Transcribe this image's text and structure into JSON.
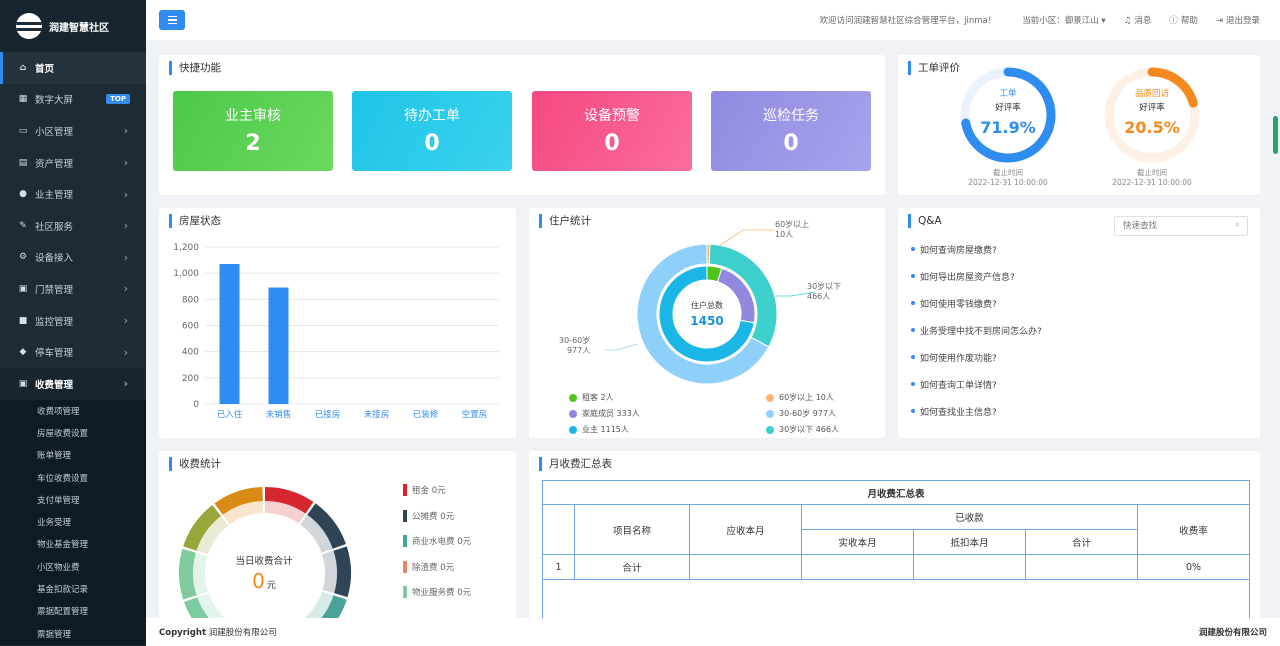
{
  "app": {
    "title": "润建智慧社区"
  },
  "sidebar": {
    "items": [
      {
        "label": "首页",
        "icon": "home-icon",
        "glyph": "⌂",
        "active": true
      },
      {
        "label": "数字大屏",
        "icon": "chart-icon",
        "glyph": "▦",
        "badge": "TOP"
      },
      {
        "label": "小区管理",
        "icon": "monitor-icon",
        "glyph": "▭",
        "arrow": "›"
      },
      {
        "label": "资产管理",
        "icon": "document-icon",
        "glyph": "▤",
        "arrow": "›"
      },
      {
        "label": "业主管理",
        "icon": "user-icon",
        "glyph": "●",
        "arrow": "›"
      },
      {
        "label": "社区服务",
        "icon": "edit-icon",
        "glyph": "✎",
        "arrow": "›"
      },
      {
        "label": "设备接入",
        "icon": "gear-icon",
        "glyph": "⚙",
        "arrow": "›"
      },
      {
        "label": "门禁管理",
        "icon": "card-icon",
        "glyph": "▣",
        "arrow": "›"
      },
      {
        "label": "监控管理",
        "icon": "camera-icon",
        "glyph": "■",
        "arrow": "›"
      },
      {
        "label": "停车管理",
        "icon": "car-icon",
        "glyph": "◆",
        "arrow": "›"
      },
      {
        "label": "收费管理",
        "icon": "money-icon",
        "glyph": "▣",
        "arrow": "›",
        "open": true
      }
    ],
    "sub_items": [
      "收费项管理",
      "房屋收费设置",
      "账单管理",
      "车位收费设置",
      "支付单管理",
      "业务受理",
      "物业基金管理",
      "小区物业费",
      "基金扣款记录",
      "票据配置管理",
      "票据管理"
    ]
  },
  "header": {
    "welcome": "欢迎访问润建智慧社区综合管理平台，jinma！",
    "community": "当前小区：御景江山 ▾",
    "messages": "消息",
    "help": "帮助",
    "logout": "退出登录"
  },
  "quick": {
    "title": "快捷功能",
    "items": [
      {
        "label": "业主审核",
        "value": "2"
      },
      {
        "label": "待办工单",
        "value": "0"
      },
      {
        "label": "设备预警",
        "value": "0"
      },
      {
        "label": "巡检任务",
        "value": "0"
      }
    ]
  },
  "eval": {
    "title": "工单评价",
    "gauges": [
      {
        "name": "工单",
        "sub": "好评率",
        "value": "71.9%",
        "percent": 71.9,
        "time_label": "截止时间",
        "time": "2022-12-31 10:00:00",
        "color": "#2f8cf0"
      },
      {
        "name": "品质回访",
        "sub": "好评率",
        "value": "20.5%",
        "percent": 20.5,
        "time_label": "截止时间",
        "time": "2022-12-31 10:00:00",
        "color": "#f5891d"
      }
    ]
  },
  "house": {
    "title": "房屋状态",
    "chart_data": {
      "type": "bar",
      "categories": [
        "已入住",
        "未销售",
        "已接房",
        "未接房",
        "已装修",
        "空置房"
      ],
      "values": [
        1070,
        890,
        0,
        0,
        0,
        0
      ],
      "yticks": [
        "0",
        "200",
        "400",
        "600",
        "800",
        "1,000",
        "1,200"
      ],
      "ylim": [
        0,
        1200
      ],
      "color": "#2f8cf0"
    }
  },
  "residents": {
    "title": "住户统计",
    "total_label": "住户总数",
    "total": "1450",
    "chart_data": {
      "type": "pie",
      "inner": [
        {
          "name": "业主",
          "value": 1115,
          "color": "#1ab7e6"
        },
        {
          "name": "家庭成员",
          "value": 333,
          "color": "#9189e0"
        },
        {
          "name": "租客",
          "value": 2,
          "color": "#52c41a"
        }
      ],
      "outer": [
        {
          "name": "30-60岁",
          "value": 977,
          "color": "#8fd0fb"
        },
        {
          "name": "30岁以下",
          "value": 466,
          "color": "#3dd0cc"
        },
        {
          "name": "60岁以上",
          "value": 10,
          "color": "#ffb37a"
        }
      ],
      "legend": [
        {
          "label": "租客  2人",
          "color": "#52c41a"
        },
        {
          "label": "60岁以上  10人",
          "color": "#ffb37a"
        },
        {
          "label": "家庭成员  333人",
          "color": "#9189e0"
        },
        {
          "label": "30-60岁  977人",
          "color": "#8fd0fb"
        },
        {
          "label": "业主  1115人",
          "color": "#1ab7e6"
        },
        {
          "label": "30岁以下  466人",
          "color": "#3dd0cc"
        }
      ],
      "callouts": [
        {
          "name": "60岁以上",
          "value": "10人"
        },
        {
          "name": "30岁以下",
          "value": "466人"
        },
        {
          "name": "30-60岁",
          "value": "977人"
        }
      ]
    }
  },
  "qa": {
    "title": "Q&A",
    "search_placeholder": "快速查找",
    "items": [
      "如何查询房屋缴费?",
      "如何导出房屋资产信息?",
      "如何使用零钱缴费?",
      "业务受理中找不到房间怎么办?",
      "如何使用作废功能?",
      "如何查询工单详情?",
      "如何查找业主信息?"
    ]
  },
  "fee": {
    "title": "收费统计",
    "center_label": "当日收费合计",
    "center_value": "0",
    "center_unit": "元",
    "legend": [
      {
        "label": "租金 0元",
        "color": "#d6262f"
      },
      {
        "label": "公摊费 0元",
        "color": "#2f4555"
      },
      {
        "label": "商业水电费 0元",
        "color": "#4aa39b"
      },
      {
        "label": "除渣费 0元",
        "color": "#e58763"
      },
      {
        "label": "物业服务费 0元",
        "color": "#7ecba0"
      }
    ]
  },
  "monthly": {
    "title": "月收费汇总表",
    "table_title": "月收费汇总表",
    "h_item": "项目名称",
    "h_due": "应收本月",
    "h_received": "已收款",
    "h_actual": "实收本月",
    "h_offset": "抵扣本月",
    "h_total": "合计",
    "h_rate": "收费率",
    "row": {
      "index": "1",
      "name": "合计",
      "rate": "0%"
    }
  },
  "footer": {
    "copyright_label": "Copyright",
    "copyright": "润建股份有限公司",
    "right": "润建股份有限公司"
  }
}
